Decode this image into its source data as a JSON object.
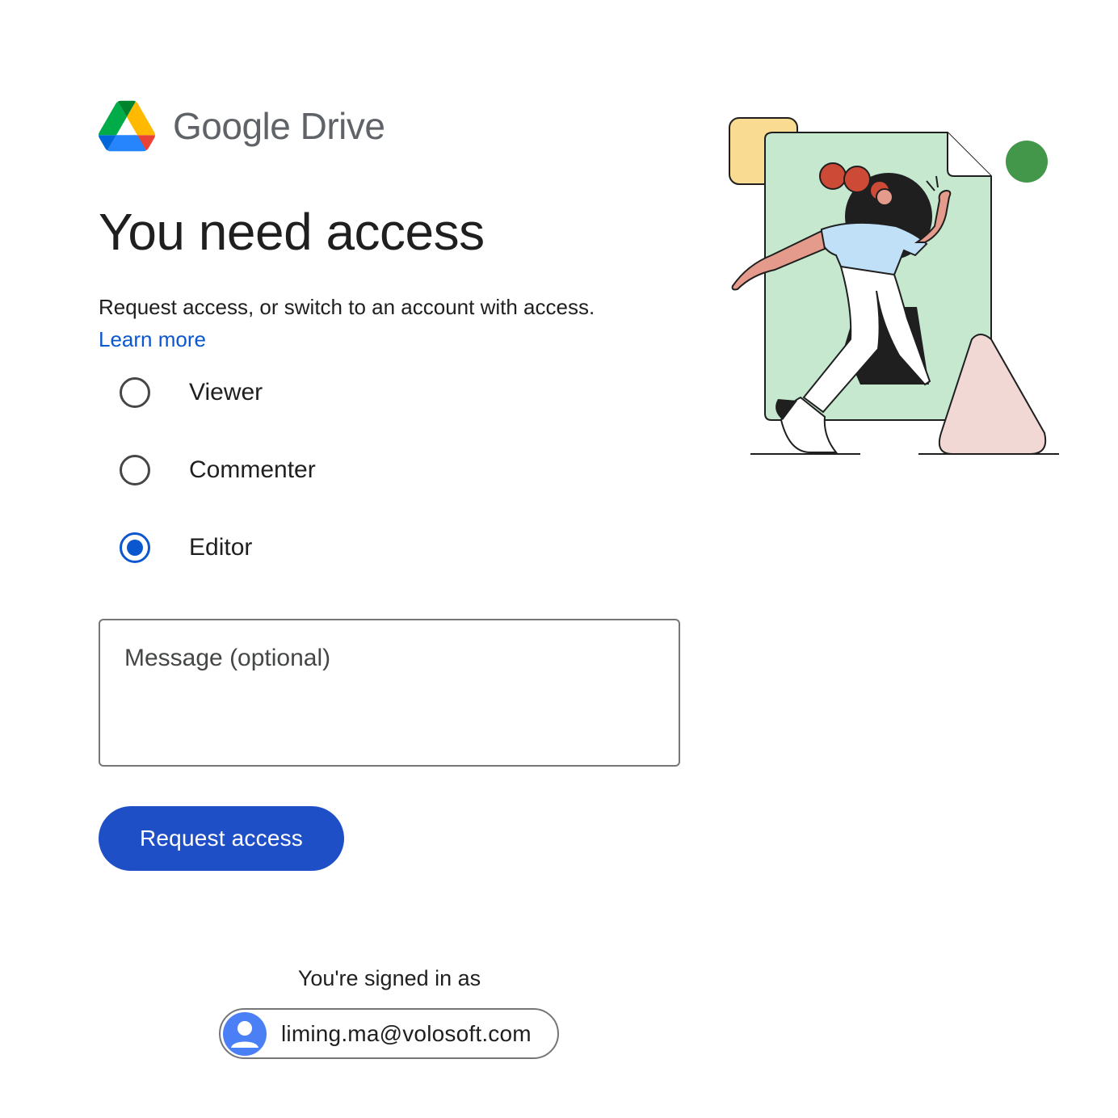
{
  "brand": {
    "google": "Google",
    "product": "Drive"
  },
  "title": "You need access",
  "subtitle": "Request access, or switch to an account with access.",
  "learn_more": "Learn more",
  "roles": [
    {
      "label": "Viewer",
      "checked": false
    },
    {
      "label": "Commenter",
      "checked": false
    },
    {
      "label": "Editor",
      "checked": true
    }
  ],
  "message": {
    "placeholder": "Message (optional)",
    "value": ""
  },
  "request_button": "Request access",
  "signed_in_label": "You're signed in as",
  "account": {
    "email": "liming.ma@volosoft.com"
  },
  "colors": {
    "accent": "#0b57d0",
    "button": "#1f4fc7",
    "avatar": "#4a7ff5"
  }
}
